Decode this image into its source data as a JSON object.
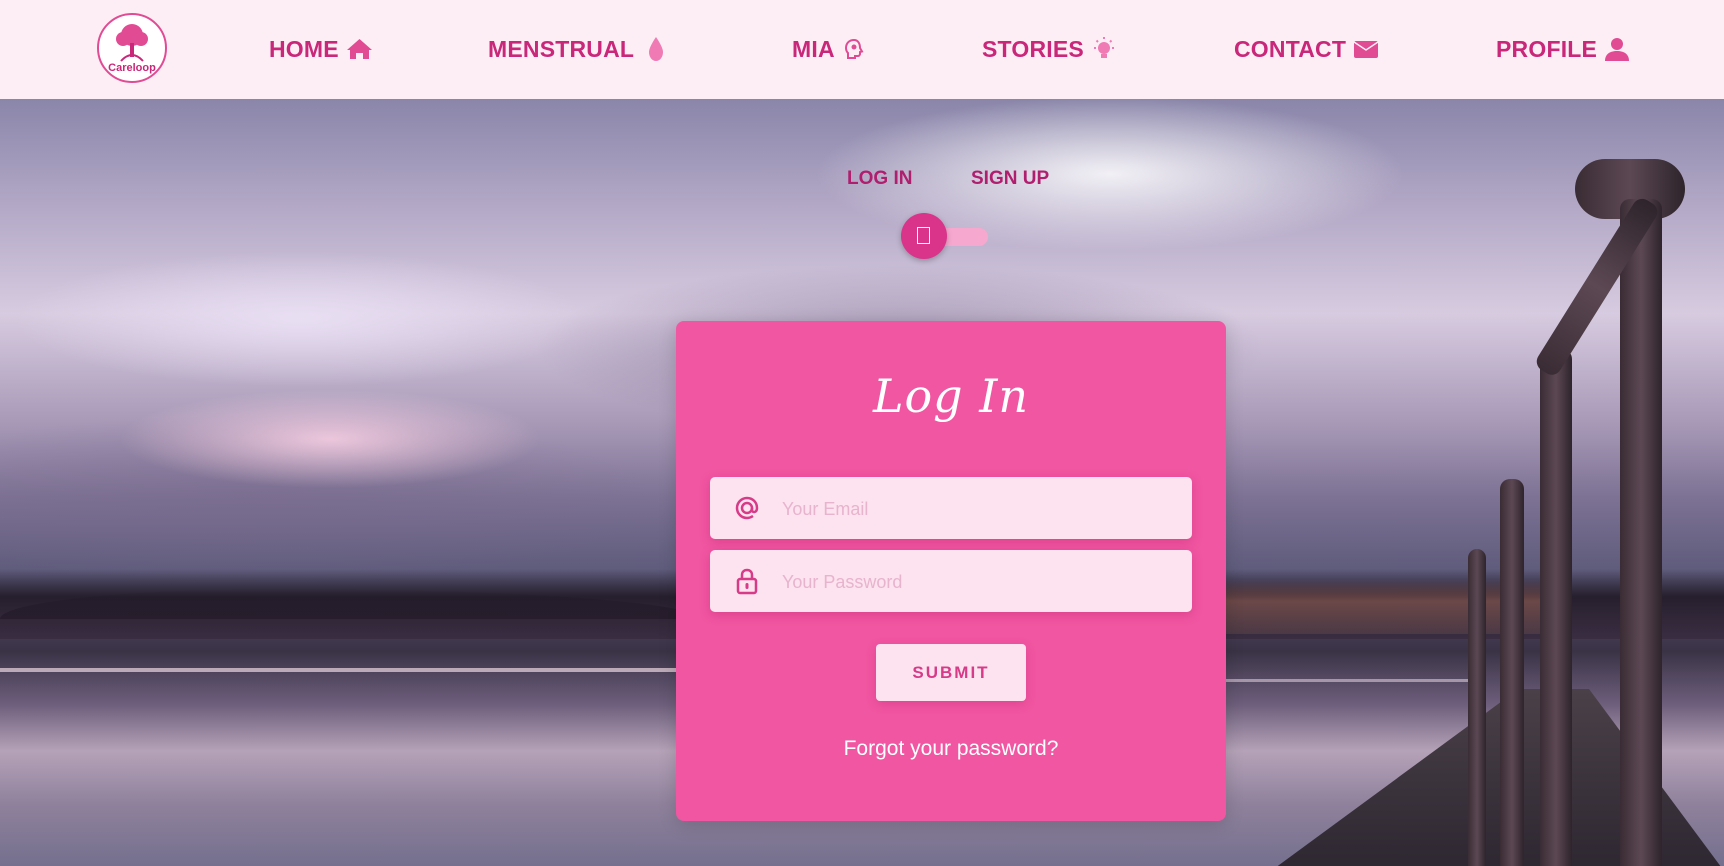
{
  "navbar": {
    "logo_text": "Careloop",
    "items": [
      {
        "label": "HOME",
        "icon": "home-icon"
      },
      {
        "label": "MENSTRUAL",
        "icon": "drop-icon"
      },
      {
        "label": "MIA",
        "icon": "head-icon"
      },
      {
        "label": "STORIES",
        "icon": "lightbulb-icon"
      },
      {
        "label": "CONTACT",
        "icon": "envelope-icon"
      },
      {
        "label": "PROFILE",
        "icon": "user-icon"
      }
    ]
  },
  "auth_toggle": {
    "login_label": "LOG IN",
    "signup_label": "SIGN UP"
  },
  "login_form": {
    "title": "Log In",
    "email": {
      "placeholder": "Your Email",
      "value": "",
      "icon": "at-icon"
    },
    "password": {
      "placeholder": "Your Password",
      "value": "",
      "icon": "lock-icon"
    },
    "submit_label": "SUBMIT",
    "forgot_label": "Forgot your password?"
  },
  "colors": {
    "brand": "#c9277a",
    "card": "#f156a2",
    "field_bg": "#fce3ef",
    "toggle_knob": "#d9338a",
    "nav_bg": "#fdeef5"
  }
}
